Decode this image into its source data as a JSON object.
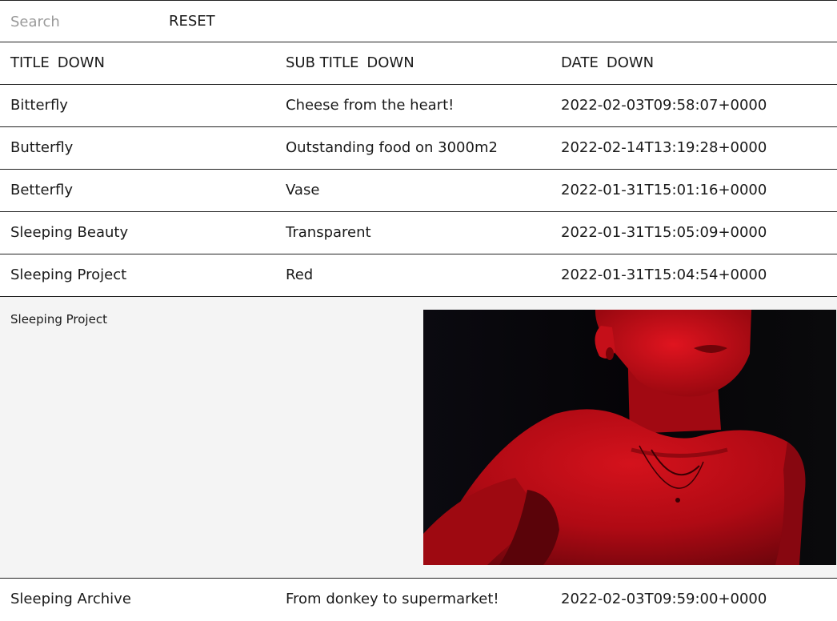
{
  "toolbar": {
    "search_placeholder": "Search",
    "search_value": "",
    "reset_label": "RESET"
  },
  "table": {
    "headers": [
      {
        "label": "TITLE",
        "sort": "DOWN"
      },
      {
        "label": "SUB TITLE",
        "sort": "DOWN"
      },
      {
        "label": "DATE",
        "sort": "DOWN"
      }
    ],
    "rows": [
      {
        "title": "Bitterfly",
        "subtitle": "Cheese from the heart!",
        "date": "2022-02-03T09:58:07+0000"
      },
      {
        "title": "Butterfly",
        "subtitle": "Outstanding food on 3000m2",
        "date": "2022-02-14T13:19:28+0000"
      },
      {
        "title": "Betterfly",
        "subtitle": "Vase",
        "date": "2022-01-31T15:01:16+0000"
      },
      {
        "title": "Sleeping Beauty",
        "subtitle": "Transparent",
        "date": "2022-01-31T15:05:09+0000"
      },
      {
        "title": "Sleeping Project",
        "subtitle": "Red",
        "date": "2022-01-31T15:04:54+0000"
      },
      {
        "title": "Sleeping Archive",
        "subtitle": "From donkey to supermarket!",
        "date": "2022-02-03T09:59:00+0000"
      }
    ],
    "expanded": {
      "title": "Sleeping Project"
    }
  },
  "colors": {
    "border": "#222222",
    "expanded_background": "#f4f4f4",
    "placeholder": "#9a9a9a",
    "photo_red": "#b00a14"
  }
}
